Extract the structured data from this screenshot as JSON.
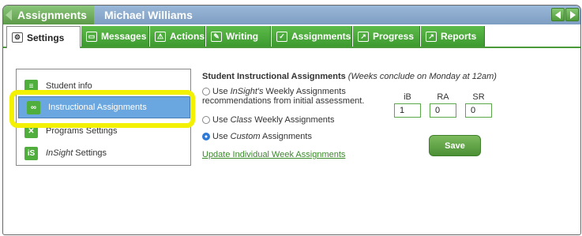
{
  "titlebar": {
    "section": "Assignments",
    "user": "Michael Williams"
  },
  "tabs": [
    {
      "label": "Settings",
      "icon": "gear-icon",
      "glyph": "⚙"
    },
    {
      "label": "Messages",
      "icon": "message-icon",
      "glyph": "▭"
    },
    {
      "label": "Actions",
      "icon": "warning-icon",
      "glyph": "⚠"
    },
    {
      "label": "Writing",
      "icon": "pencil-icon",
      "glyph": "✎"
    },
    {
      "label": "Assignments",
      "icon": "checkmark-icon",
      "glyph": "✓"
    },
    {
      "label": "Progress",
      "icon": "chart-icon",
      "glyph": "↗"
    },
    {
      "label": "Reports",
      "icon": "report-icon",
      "glyph": "↗"
    }
  ],
  "sidebar": {
    "items": [
      {
        "label": "Student info",
        "icon": "student-info-icon",
        "glyph": "≡"
      },
      {
        "label": "Instructional Assignments",
        "icon": "assignments-icon",
        "glyph": "∞"
      },
      {
        "label": "Programs Settings",
        "icon": "programs-icon",
        "glyph": "✕"
      },
      {
        "label_italic": "InSight",
        "label_rest": " Settings",
        "icon": "insight-icon",
        "glyph": "iS"
      }
    ]
  },
  "main": {
    "heading": "Student Instructional Assignments",
    "heading_note": "(Weeks conclude on Monday at 12am)",
    "options": [
      {
        "pre": "Use ",
        "em": "InSight's",
        "post": " Weekly Assignments",
        "line2": "recommendations from initial assessment.",
        "checked": false
      },
      {
        "pre": "Use ",
        "em": "Class",
        "post": " Weekly Assignments",
        "checked": false
      },
      {
        "pre": "Use ",
        "em": "Custom",
        "post": " Assignments",
        "checked": true
      }
    ],
    "link": "Update Individual Week Assignments",
    "columns": [
      "iB",
      "RA",
      "SR"
    ],
    "values": [
      "1",
      "0",
      "0"
    ],
    "save_label": "Save"
  },
  "colors": {
    "accent_green": "#4a9a3a",
    "selected_blue": "#6aa7e0",
    "highlight_yellow": "#f3f000"
  }
}
